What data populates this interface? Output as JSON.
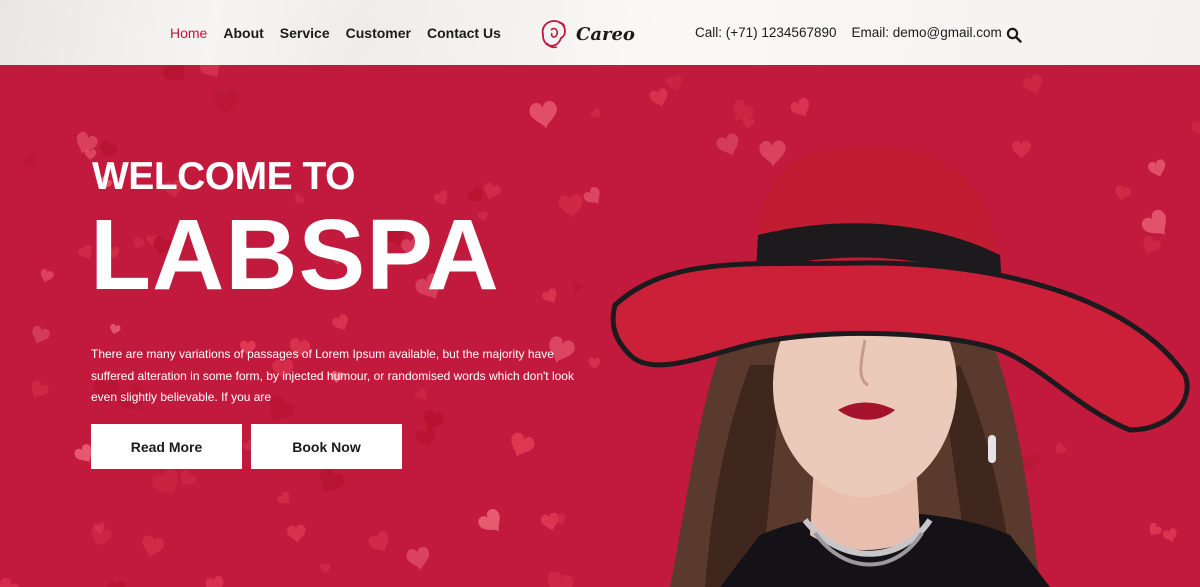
{
  "nav": {
    "items": [
      {
        "label": "Home",
        "active": true
      },
      {
        "label": "About",
        "active": false
      },
      {
        "label": "Service",
        "active": false
      },
      {
        "label": "Customer",
        "active": false
      },
      {
        "label": "Contact Us",
        "active": false
      }
    ]
  },
  "logo": {
    "text": "Careo",
    "icon": "woman-profile-icon"
  },
  "contact": {
    "call": "Call: (+71) 1234567890",
    "email": "Email: demo@gmail.com"
  },
  "search": {
    "icon": "search-icon"
  },
  "hero": {
    "subtitle": "WELCOME TO",
    "title": "LABSPA",
    "text": "There are many variations of passages of Lorem Ipsum available, but the majority have suffered alteration in some form, by injected humour, or randomised words which don't look even slightly believable. If you are",
    "buttons": {
      "read_more": "Read More",
      "book_now": "Book Now"
    }
  },
  "colors": {
    "accent": "#c0163c",
    "nav_bg": "#f7f5f3",
    "text": "#1b1b1b",
    "button_bg": "#ffffff"
  }
}
